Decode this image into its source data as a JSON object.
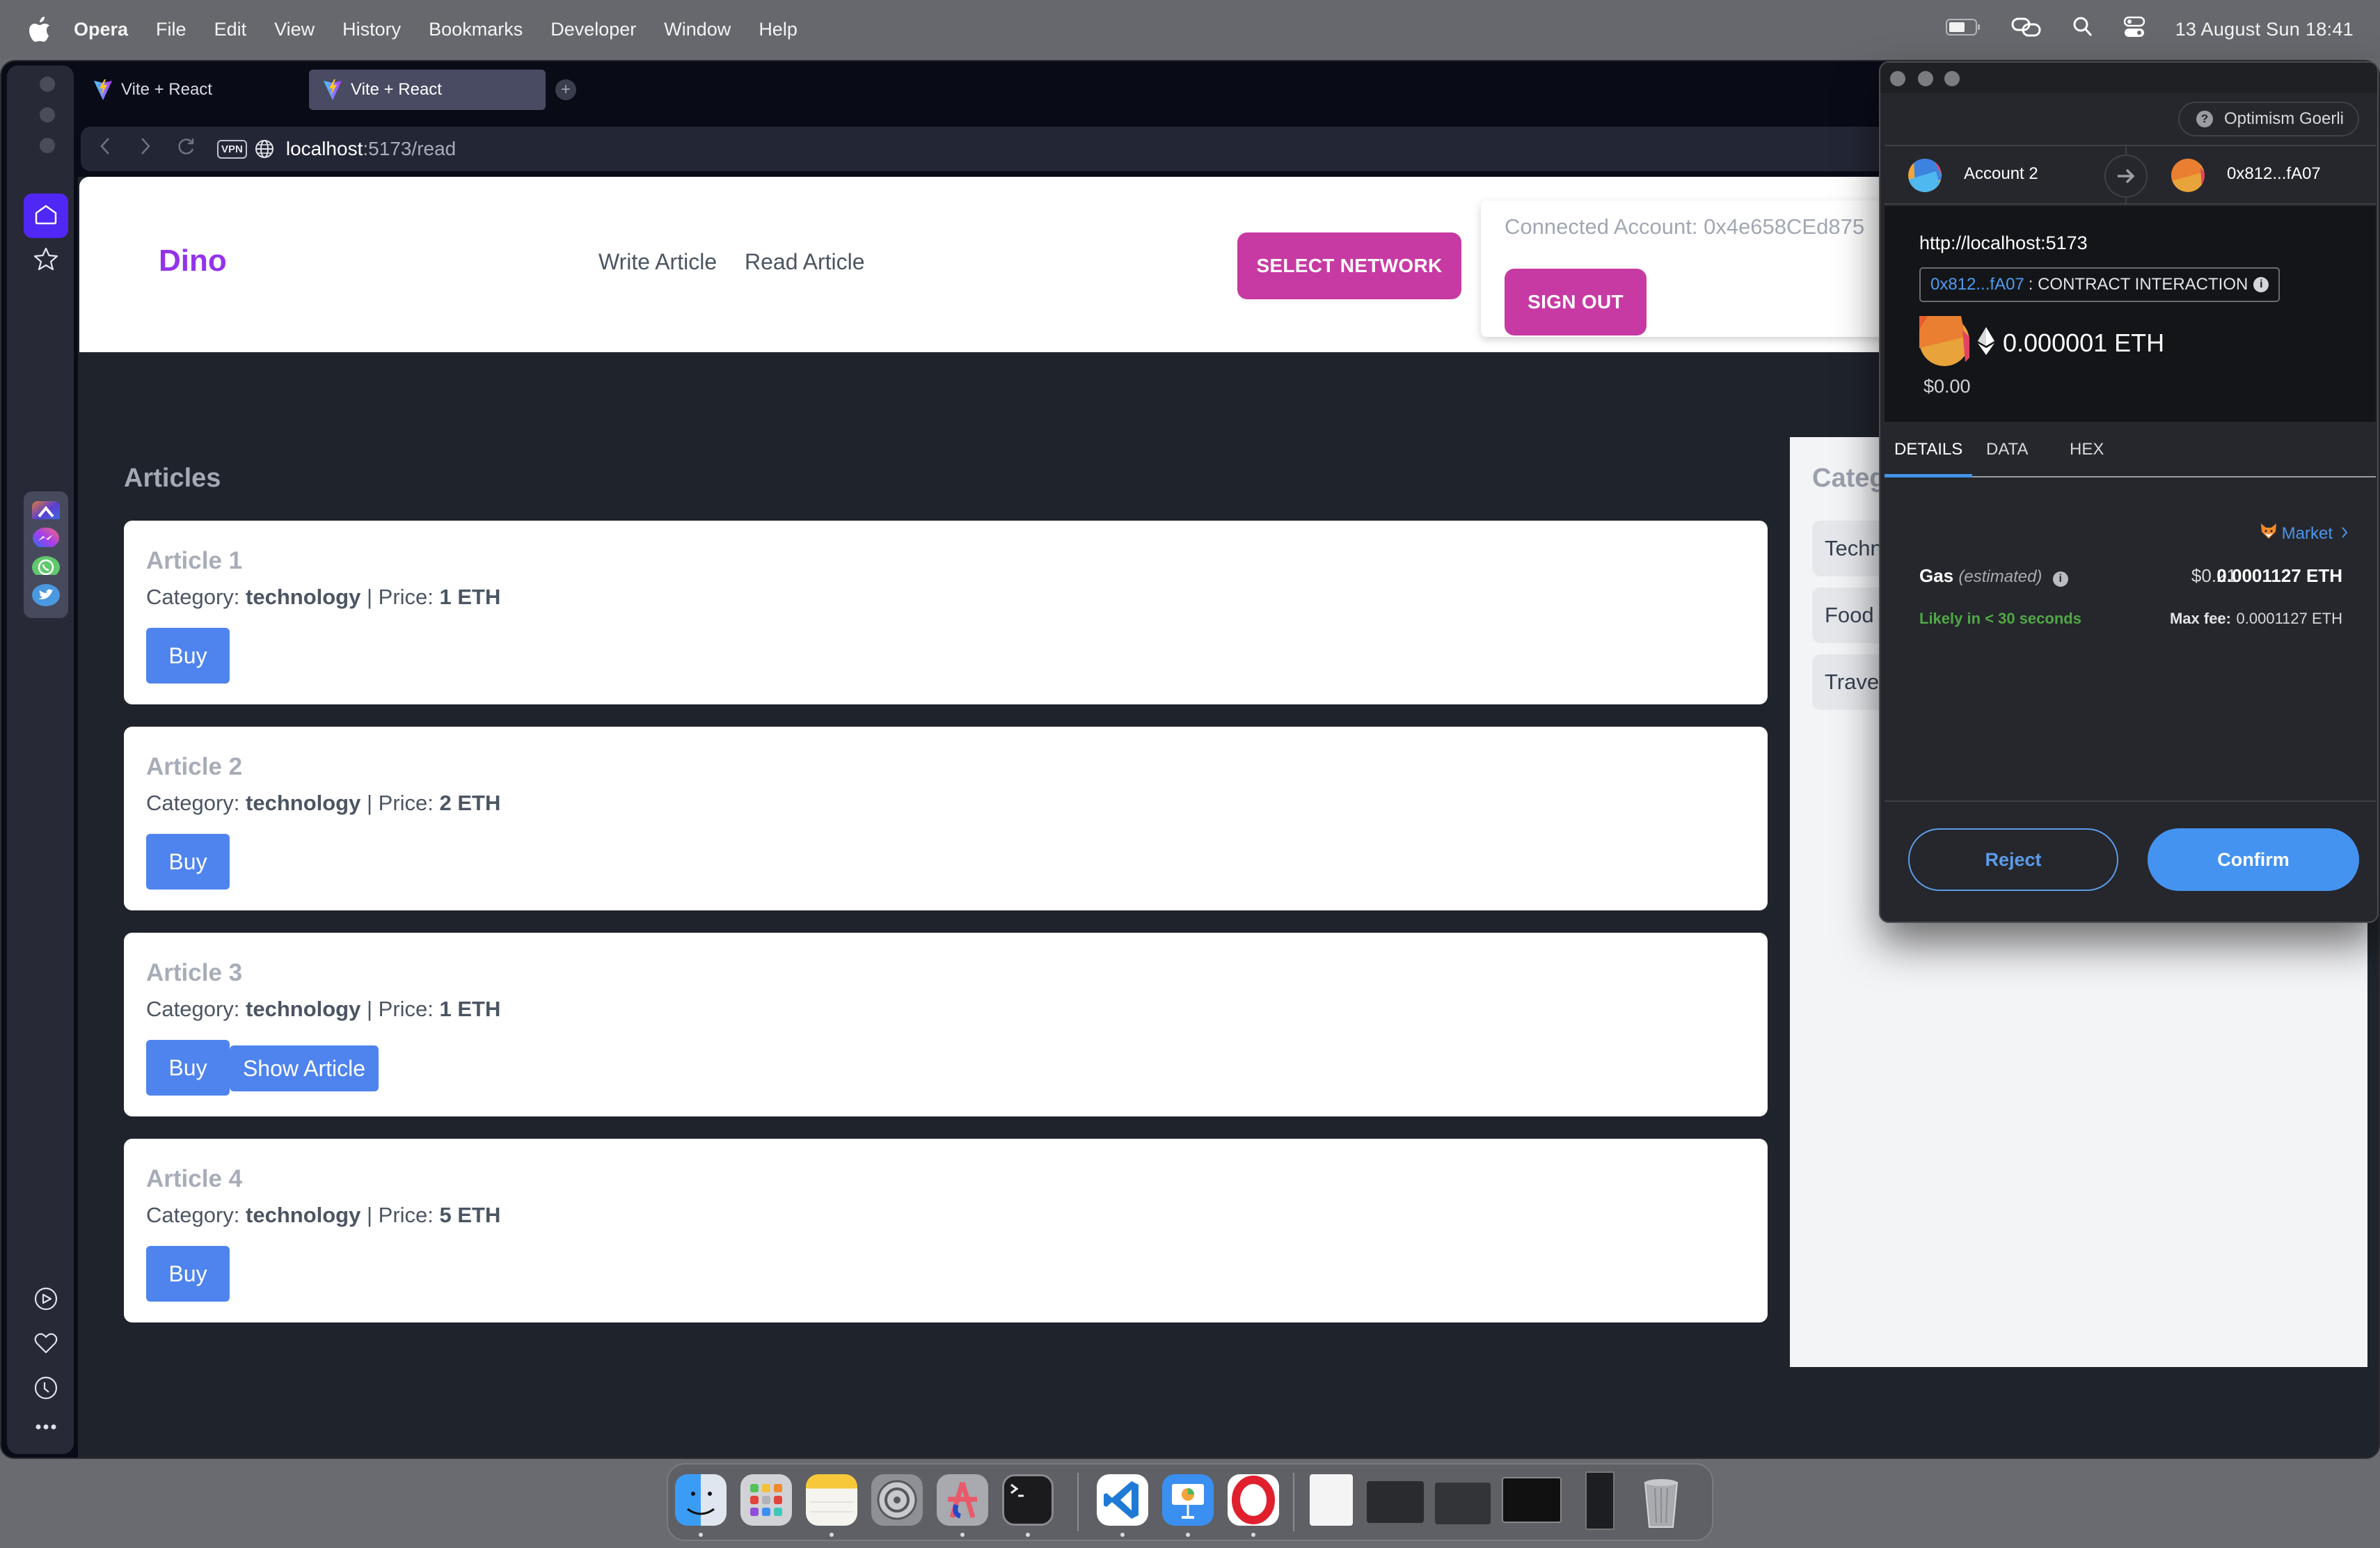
{
  "menubar": {
    "app_name": "Opera",
    "items": [
      "File",
      "Edit",
      "View",
      "History",
      "Bookmarks",
      "Developer",
      "Window",
      "Help"
    ],
    "status_icons": [
      "battery-icon",
      "link-icon",
      "spotlight-search-icon",
      "control-center-icon"
    ],
    "datetime": "13 August Sun  18:41"
  },
  "browser": {
    "tabs": [
      {
        "title": "Vite + React",
        "active": false,
        "icon": "vite-icon"
      },
      {
        "title": "Vite + React",
        "active": true,
        "icon": "vite-icon"
      }
    ],
    "new_tab_label": "+",
    "address": {
      "host": "localhost",
      "rest": ":5173/read",
      "vpn_label": "VPN"
    },
    "sidebar": {
      "top": [
        "home-icon",
        "star-icon"
      ],
      "apps": [
        "aria-icon",
        "messenger-icon",
        "whatsapp-icon",
        "twitter-icon"
      ],
      "bottom": [
        "player-icon",
        "heart-icon",
        "history-clock-icon",
        "more-icon"
      ]
    }
  },
  "page": {
    "brand": "Dino",
    "nav": [
      "Write Article",
      "Read Article"
    ],
    "select_network_label": "SELECT NETWORK",
    "connected_account": "Connected Account: 0x4e658CEd875",
    "sign_out_label": "SIGN OUT",
    "articles_title": "Articles",
    "category_prefix": "Category: ",
    "price_prefix": " | Price: ",
    "articles": [
      {
        "title": "Article 1",
        "category": "technology",
        "price": "1 ETH",
        "buttons": [
          "Buy"
        ]
      },
      {
        "title": "Article 2",
        "category": "technology",
        "price": "2 ETH",
        "buttons": [
          "Buy"
        ]
      },
      {
        "title": "Article 3",
        "category": "technology",
        "price": "1 ETH",
        "buttons": [
          "Buy",
          "Show Article"
        ]
      },
      {
        "title": "Article 4",
        "category": "technology",
        "price": "5 ETH",
        "buttons": [
          "Buy"
        ]
      }
    ],
    "categories_title": "Categ",
    "categories": [
      "Techn",
      "Food",
      "Trave"
    ]
  },
  "metamask": {
    "network": "Optimism Goerli",
    "from_account": "Account 2",
    "to_account": "0x812...fA07",
    "origin": "http://localhost:5173",
    "contract_address": "0x812...fA07",
    "contract_label": " : CONTRACT INTERACTION",
    "amount": "0.000001 ETH",
    "amount_usd": "$0.00",
    "tabs": [
      "DETAILS",
      "DATA",
      "HEX"
    ],
    "active_tab": "DETAILS",
    "market_label": "Market",
    "gas_label": "Gas",
    "gas_estimated": "(estimated)",
    "gas_usd": "$0.21",
    "gas_eth": "0.0001127 ETH",
    "likely": "Likely in < 30 seconds",
    "max_fee_label": "Max fee:",
    "max_fee_value": "0.0001127 ETH",
    "reject_label": "Reject",
    "confirm_label": "Confirm",
    "colors": {
      "accent": "#4493f0",
      "success": "#4fa845"
    }
  },
  "dock": {
    "apps": [
      {
        "name": "finder",
        "running": true
      },
      {
        "name": "launchpad",
        "running": false
      },
      {
        "name": "notes",
        "running": true
      },
      {
        "name": "system-settings",
        "running": false
      },
      {
        "name": "aria-app",
        "running": true
      },
      {
        "name": "terminal",
        "running": true
      },
      {
        "name": "vscode",
        "running": true
      },
      {
        "name": "keynote",
        "running": true
      },
      {
        "name": "opera",
        "running": true
      }
    ],
    "minimized_windows": 5,
    "trash": "trash"
  },
  "colors": {
    "brand": "#9333ea",
    "pink_button": "#c73aa3",
    "blue_button": "#4f84ee",
    "page_bg": "#1f232b"
  }
}
